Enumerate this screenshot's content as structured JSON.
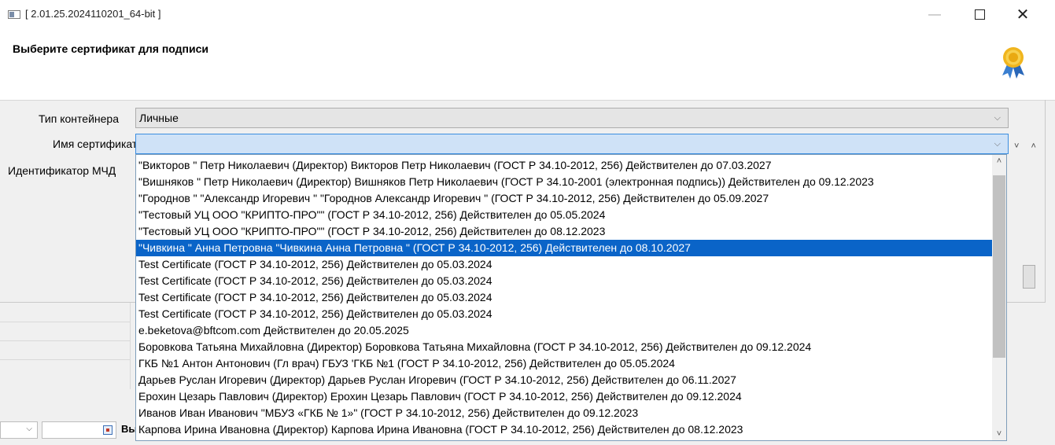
{
  "window": {
    "title": "[ 2.01.25.2024110201_64-bit ]",
    "minimize_glyph": "—",
    "close_glyph": "✕"
  },
  "header": {
    "title": "Выберите сертификат для подписи",
    "icon": "award-medal-icon"
  },
  "form": {
    "container_type_label": "Тип контейнера",
    "container_type_value": "Личные",
    "certificate_name_label": "Имя сертификата",
    "certificate_name_value": "",
    "mcd_label": "Идентификатор МЧД",
    "chevron_glyph": "⌵",
    "side_arrows": "˅ ˄"
  },
  "certificate_list": {
    "selected_index": 5,
    "items": [
      "\"Викторов \" Петр Николаевич (Директор) Викторов Петр Николаевич (ГОСТ Р 34.10-2012, 256) Действителен до 07.03.2027",
      "\"Вишняков \" Петр Николаевич (Директор) Вишняков Петр Николаевич (ГОСТ Р 34.10-2001 (электронная подпись)) Действителен до 09.12.2023",
      "\"Городнов \" \"Александр Игоревич \" \"Городнов  Александр Игоревич \" (ГОСТ Р 34.10-2012, 256) Действителен до 05.09.2027",
      "\"Тестовый УЦ ООО \"КРИПТО-ПРО\"\" (ГОСТ Р 34.10-2012, 256) Действителен до 05.05.2024",
      "\"Тестовый УЦ ООО \"КРИПТО-ПРО\"\" (ГОСТ Р 34.10-2012, 256) Действителен до 08.12.2023",
      "\"Чивкина \" Анна Петровна \"Чивкина Анна Петровна \" (ГОСТ Р 34.10-2012, 256) Действителен до 08.10.2027",
      "Test Certificate (ГОСТ Р 34.10-2012, 256) Действителен до 05.03.2024",
      "Test Certificate (ГОСТ Р 34.10-2012, 256) Действителен до 05.03.2024",
      "Test Certificate (ГОСТ Р 34.10-2012, 256) Действителен до 05.03.2024",
      "Test Certificate (ГОСТ Р 34.10-2012, 256) Действителен до 05.03.2024",
      "e.beketova@bftcom.com Действителен до 20.05.2025",
      "Боровкова Татьяна Михайловна (Директор) Боровкова Татьяна Михайловна (ГОСТ Р 34.10-2012, 256) Действителен до 09.12.2024",
      "ГКБ №1 Антон Антонович (Гл врач) ГБУЗ 'ГКБ №1 (ГОСТ Р 34.10-2012, 256) Действителен до 05.05.2024",
      "Дарьев Руслан Игоревич (Директор) Дарьев Руслан Игоревич (ГОСТ Р 34.10-2012, 256) Действителен до 06.11.2027",
      "Ерохин Цезарь Павлович (Директор) Ерохин Цезарь Павлович (ГОСТ Р 34.10-2012, 256) Действителен до 09.12.2024",
      "Иванов Иван Иванович \"МБУЗ «ГКБ  № 1»\" (ГОСТ Р 34.10-2012, 256) Действителен до 09.12.2023",
      "Карпова Ирина Ивановна (Директор) Карпова Ирина Ивановна (ГОСТ Р 34.10-2012, 256) Действителен до 08.12.2023"
    ],
    "scroll_up_glyph": "˄",
    "scroll_down_glyph": "˅"
  },
  "background": {
    "partial_text": "Вы"
  },
  "colors": {
    "selection": "#0a64c8",
    "active_field": "#cfe2f7",
    "active_border": "#3b8ee0"
  }
}
